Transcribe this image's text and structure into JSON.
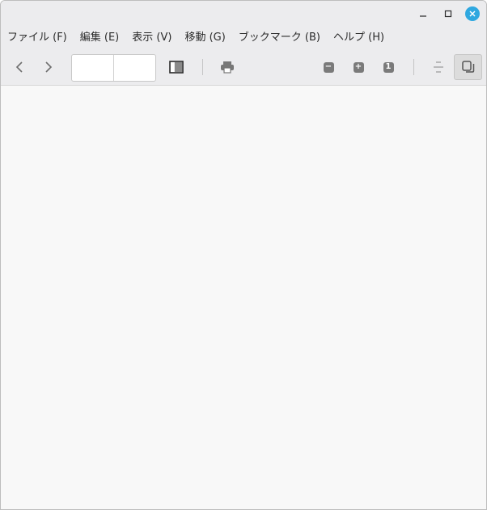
{
  "window": {
    "controls": {
      "minimize_icon": "minimize-icon",
      "maximize_icon": "maximize-icon",
      "close_icon": "close-icon",
      "close_color": "#2fa8e0"
    }
  },
  "menubar": {
    "items": [
      {
        "label": "ファイル (F)"
      },
      {
        "label": "編集 (E)"
      },
      {
        "label": "表示 (V)"
      },
      {
        "label": "移動 (G)"
      },
      {
        "label": "ブックマーク (B)"
      },
      {
        "label": "ヘルプ (H)"
      }
    ]
  },
  "toolbar": {
    "back_icon": "chevron-left-icon",
    "forward_icon": "chevron-right-icon",
    "page_current": "",
    "page_total": "",
    "sidebar_icon": "sidebar-toggle-icon",
    "print_icon": "printer-icon",
    "zoom_out_icon": "minus-icon",
    "zoom_out_glyph": "−",
    "zoom_in_icon": "plus-icon",
    "zoom_in_glyph": "+",
    "zoom_reset_icon": "original-size-icon",
    "zoom_reset_glyph": "1",
    "continuous_icon": "continuous-scroll-icon",
    "dual_page_icon": "dual-page-icon"
  }
}
